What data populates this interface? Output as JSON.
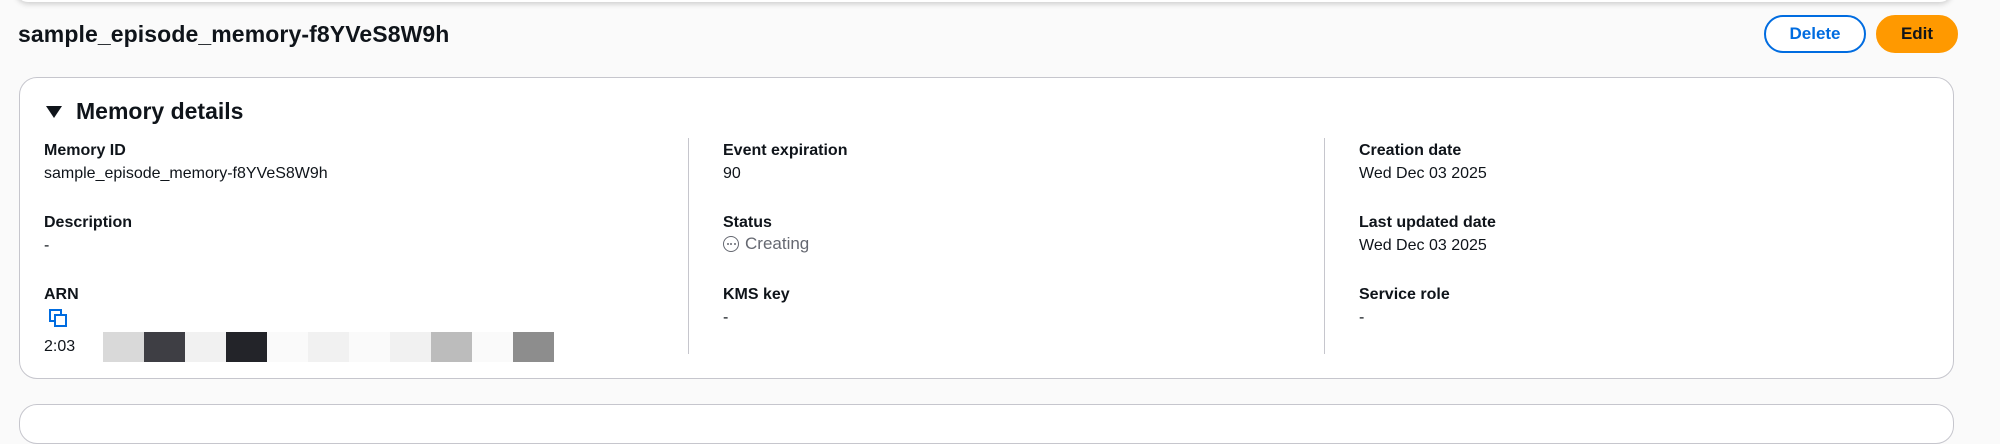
{
  "header": {
    "title": "sample_episode_memory-f8YVeS8W9h",
    "delete_label": "Delete",
    "edit_label": "Edit"
  },
  "memory_details": {
    "title": "Memory details",
    "memory_id": {
      "label": "Memory ID",
      "value": "sample_episode_memory-f8YVeS8W9h"
    },
    "description": {
      "label": "Description",
      "value": "-"
    },
    "arn": {
      "label": "ARN",
      "value": "2:03"
    },
    "event_expiration": {
      "label": "Event expiration",
      "value": "90"
    },
    "status": {
      "label": "Status",
      "value": "Creating"
    },
    "kms_key": {
      "label": "KMS key",
      "value": "-"
    },
    "creation_date": {
      "label": "Creation date",
      "value": "Wed Dec 03 2025"
    },
    "last_updated_date": {
      "label": "Last updated date",
      "value": "Wed Dec 03 2025"
    },
    "service_role": {
      "label": "Service role",
      "value": "-"
    }
  },
  "icons": {
    "expand": "caret-down-icon",
    "status": "in-progress-icon",
    "copy": "copy-icon"
  },
  "colors": {
    "primary": "#006ce0",
    "edit_button": "#ff9900",
    "border": "#c6c6cd",
    "status_text": "#656871"
  }
}
